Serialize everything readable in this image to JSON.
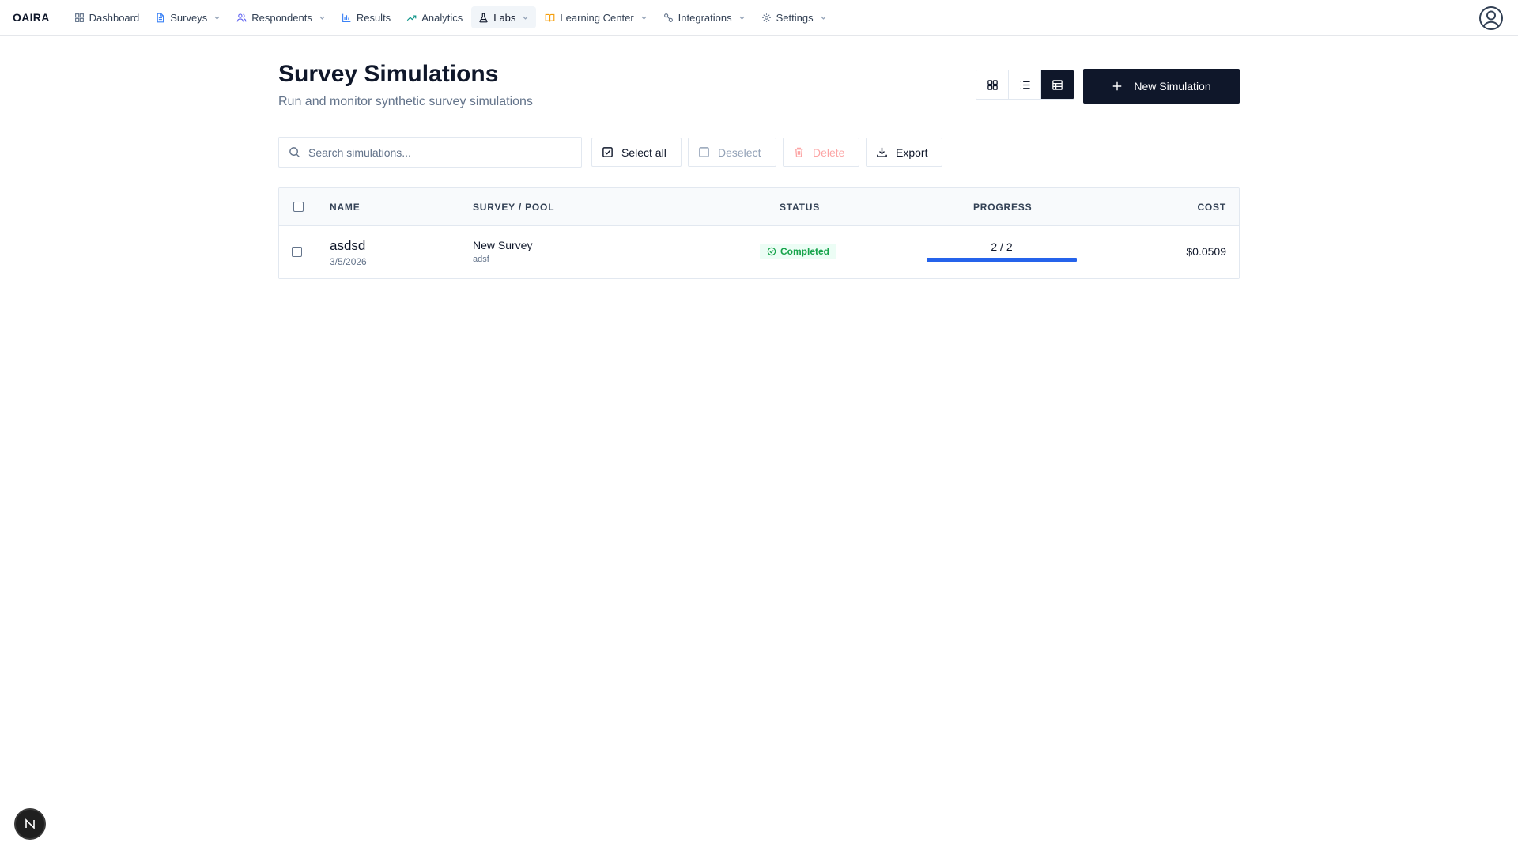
{
  "brand": "OAIRA",
  "nav": [
    {
      "label": "Dashboard",
      "icon": "dashboard-icon",
      "dropdown": false
    },
    {
      "label": "Surveys",
      "icon": "file-icon",
      "dropdown": true
    },
    {
      "label": "Respondents",
      "icon": "users-icon",
      "dropdown": true
    },
    {
      "label": "Results",
      "icon": "bar-chart-icon",
      "dropdown": false
    },
    {
      "label": "Analytics",
      "icon": "trending-up-icon",
      "dropdown": false
    },
    {
      "label": "Labs",
      "icon": "flask-icon",
      "dropdown": true,
      "active": true
    },
    {
      "label": "Learning Center",
      "icon": "book-icon",
      "dropdown": true
    },
    {
      "label": "Integrations",
      "icon": "plug-icon",
      "dropdown": true
    },
    {
      "label": "Settings",
      "icon": "gear-icon",
      "dropdown": true
    }
  ],
  "page": {
    "title": "Survey Simulations",
    "subtitle": "Run and monitor synthetic survey simulations"
  },
  "view_toggle": {
    "options": [
      "grid",
      "list",
      "table"
    ],
    "selected": "table"
  },
  "new_button": "New Simulation",
  "search": {
    "placeholder": "Search simulations...",
    "value": ""
  },
  "toolbar": {
    "select_all": "Select all",
    "deselect": "Deselect",
    "delete": "Delete",
    "export": "Export"
  },
  "table": {
    "headers": {
      "name": "NAME",
      "survey_pool": "SURVEY / POOL",
      "status": "STATUS",
      "progress": "PROGRESS",
      "cost": "COST"
    },
    "rows": [
      {
        "name": "asdsd",
        "date": "3/5/2026",
        "survey": "New Survey",
        "pool": "adsf",
        "status": "Completed",
        "progress_text": "2 / 2",
        "progress_fraction": 1.0,
        "cost": "$0.0509"
      }
    ]
  },
  "fab_label": "N",
  "colors": {
    "primary": "#0f172a",
    "progress": "#2563eb",
    "status_completed": "#16a34a",
    "delete_disabled": "#fca5a5"
  }
}
